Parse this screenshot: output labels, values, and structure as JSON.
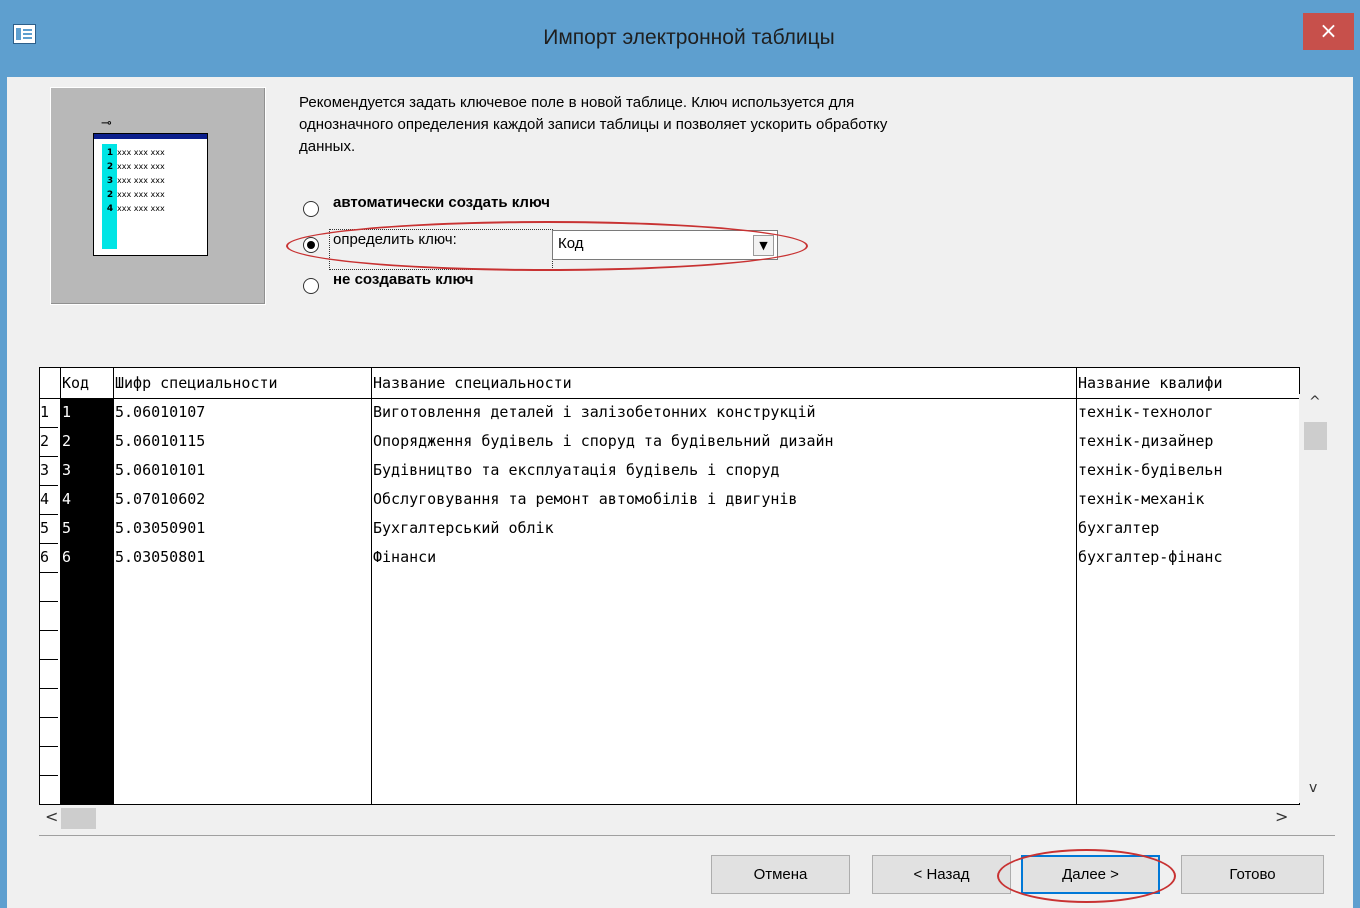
{
  "window": {
    "title": "Импорт электронной таблицы",
    "close_label": "×"
  },
  "illustration": {
    "key_glyph": "⊸",
    "rows": [
      {
        "n": "1",
        "x": "xxx xxx xxx"
      },
      {
        "n": "2",
        "x": "xxx xxx xxx"
      },
      {
        "n": "3",
        "x": "xxx xxx xxx"
      },
      {
        "n": "2",
        "x": "xxx xxx xxx"
      },
      {
        "n": "4",
        "x": "xxx xxx xxx"
      }
    ]
  },
  "description": {
    "line1": "Рекомендуется задать ключевое поле в новой таблице.  Ключ используется для",
    "line2": "однозначного определения каждой записи таблицы и позволяет ускорить обработку",
    "line3": "данных."
  },
  "options": {
    "auto_key": "автоматически создать ключ",
    "define_key": "определить ключ:",
    "no_key": "не создавать ключ",
    "selected": "define_key",
    "key_field_value": "Код"
  },
  "grid": {
    "columns": [
      "Код",
      "Шифр специальности",
      "Название специальности",
      "Название квалифи"
    ],
    "rows": [
      {
        "n": "1",
        "kod": "1",
        "shifr": "5.06010107",
        "nazva": "Виготовлення деталей і залізобетонних конструкцій",
        "kval": "технік-технолог"
      },
      {
        "n": "2",
        "kod": "2",
        "shifr": "5.06010115",
        "nazva": "Опорядження будівель і споруд та будівельний дизайн",
        "kval": "технік-дизайнер"
      },
      {
        "n": "3",
        "kod": "3",
        "shifr": "5.06010101",
        "nazva": "Будівництво та експлуатація будівель і споруд",
        "kval": "технік-будівельн"
      },
      {
        "n": "4",
        "kod": "4",
        "shifr": "5.07010602",
        "nazva": "Обслуговування та ремонт автомобілів і двигунів",
        "kval": "технік-механік"
      },
      {
        "n": "5",
        "kod": "5",
        "shifr": "5.03050901",
        "nazva": "Бухгалтерський облік",
        "kval": "бухгалтер"
      },
      {
        "n": "6",
        "kod": "6",
        "shifr": "5.03050801",
        "nazva": "Фінанси",
        "kval": "бухгалтер-фінанс"
      }
    ]
  },
  "scroll": {
    "up": "^",
    "down": "v",
    "left": "<",
    "right": ">"
  },
  "buttons": {
    "cancel": "Отмена",
    "back": "< Назад",
    "next": "Далее >",
    "finish": "Готово"
  },
  "colors": {
    "titlebar": "#5e9fcf",
    "close": "#c7504b",
    "highlight_ellipse": "#c83232"
  }
}
